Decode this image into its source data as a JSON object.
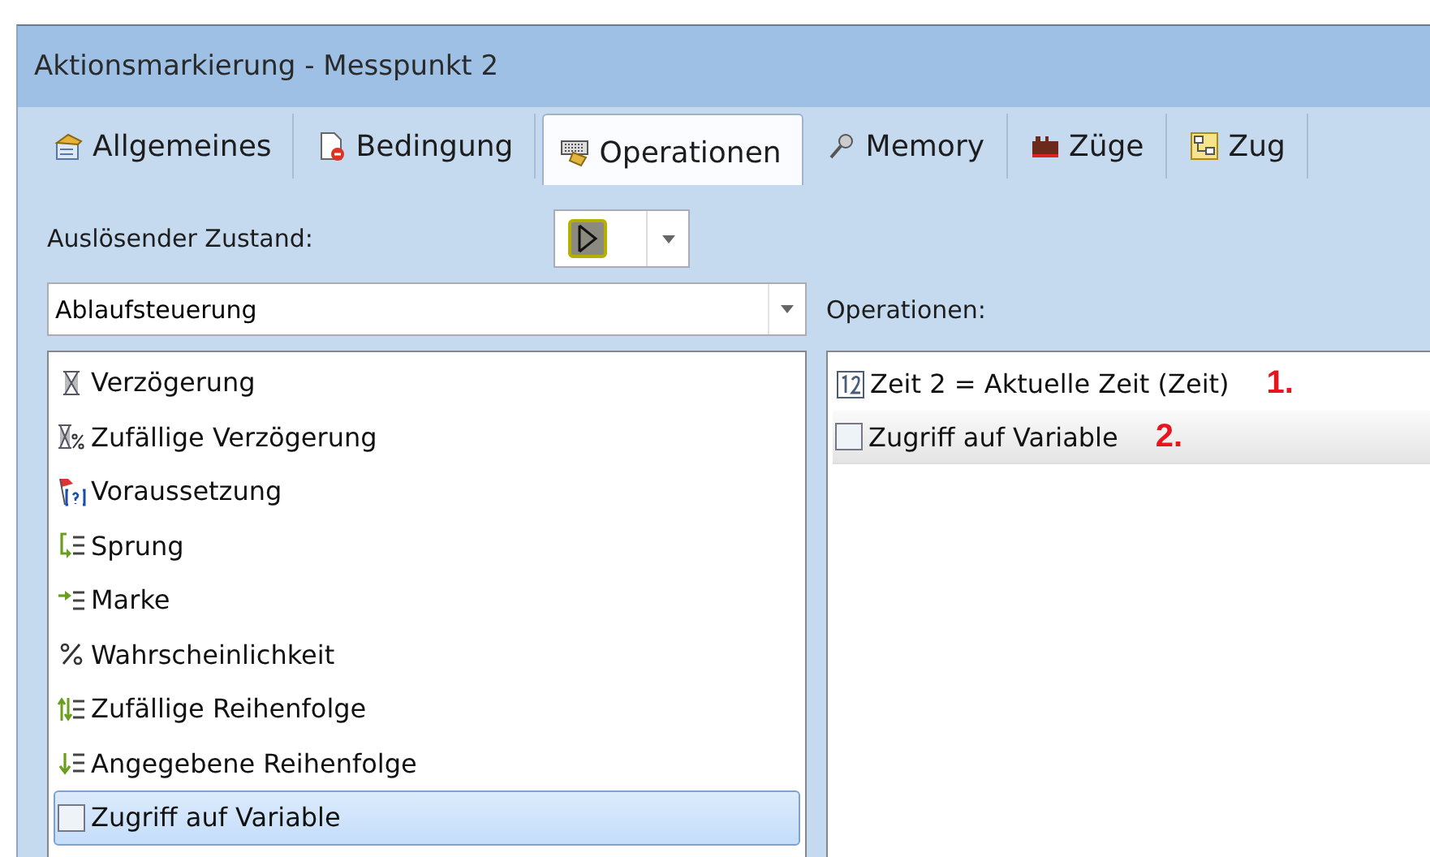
{
  "window": {
    "title": "Aktionsmarkierung - Messpunkt 2"
  },
  "tabs": [
    {
      "label": "Allgemeines",
      "kind": "general",
      "selected": false
    },
    {
      "label": "Bedingung",
      "kind": "condition",
      "selected": false
    },
    {
      "label": "Operationen",
      "kind": "operations",
      "selected": true
    },
    {
      "label": "Memory",
      "kind": "memory",
      "selected": false
    },
    {
      "label": "Züge",
      "kind": "trains",
      "selected": false
    },
    {
      "label": "Zug",
      "kind": "train",
      "selected": false
    }
  ],
  "trigger": {
    "label": "Auslösender Zustand:"
  },
  "category": {
    "value": "Ablaufsteuerung"
  },
  "available": [
    {
      "label": "Verzögerung",
      "kind": "hourglass",
      "selected": false
    },
    {
      "label": "Zufällige Verzögerung",
      "kind": "hourglass-percent",
      "selected": false
    },
    {
      "label": "Voraussetzung",
      "kind": "flag",
      "selected": false
    },
    {
      "label": "Sprung",
      "kind": "jump",
      "selected": false
    },
    {
      "label": "Marke",
      "kind": "mark",
      "selected": false
    },
    {
      "label": "Wahrscheinlichkeit",
      "kind": "percent",
      "selected": false
    },
    {
      "label": "Zufällige Reihenfolge",
      "kind": "shuffle",
      "selected": false
    },
    {
      "label": "Angegebene Reihenfolge",
      "kind": "order",
      "selected": false
    },
    {
      "label": "Zugriff auf Variable",
      "kind": "blank",
      "selected": true
    }
  ],
  "operations": {
    "label": "Operationen:",
    "items": [
      {
        "label": "Zeit 2 = Aktuelle Zeit (Zeit)",
        "kind": "number",
        "selected": false,
        "marker": "1."
      },
      {
        "label": "Zugriff auf Variable",
        "kind": "blank",
        "selected": true,
        "marker": "2."
      }
    ]
  }
}
